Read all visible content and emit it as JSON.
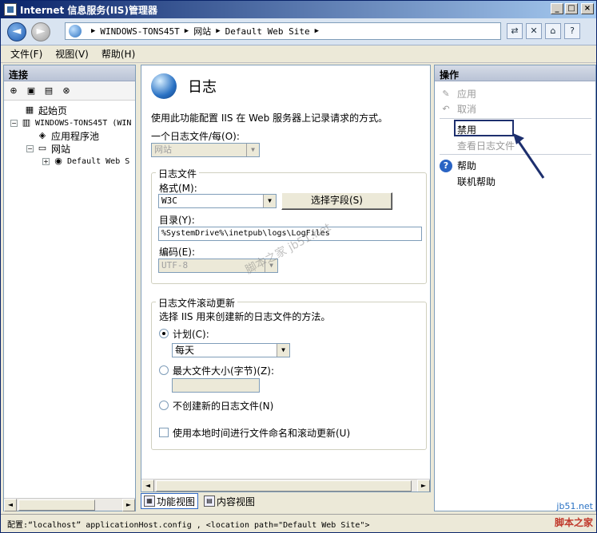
{
  "window": {
    "title": "Internet 信息服务(IIS)管理器",
    "min": "_",
    "max": "□",
    "close": "×"
  },
  "address": {
    "nav_back": "◄",
    "nav_forward": "►",
    "sep": "▶",
    "segments": [
      "WINDOWS-TONS45T",
      "网站",
      "Default Web Site"
    ],
    "tb_icons": [
      "⇄",
      "✕",
      "⌂",
      "?"
    ]
  },
  "menu": {
    "file": "文件(F)",
    "view": "视图(V)",
    "help": "帮助(H)"
  },
  "left": {
    "header": "连接",
    "tree": {
      "start_page": "起始页",
      "server": "WINDOWS-TONS45T (WIN",
      "app_pools": "应用程序池",
      "sites": "网站",
      "default_site": "Default Web S"
    },
    "expand_minus": "−",
    "expand_plus": "+"
  },
  "center": {
    "title": "日志",
    "description": "使用此功能配置 IIS 在 Web 服务器上记录请求的方式。",
    "one_log_per_label": "一个日志文件/每(O):",
    "one_log_per_value": "网站",
    "log_file_group": "日志文件",
    "format_label": "格式(M):",
    "format_value": "W3C",
    "select_fields_button": "选择字段(S)",
    "directory_label": "目录(Y):",
    "directory_value": "%SystemDrive%\\inetpub\\logs\\LogFiles",
    "encoding_label": "编码(E):",
    "encoding_value": "UTF-8",
    "rollover_group": "日志文件滚动更新",
    "rollover_desc": "选择 IIS 用来创建新的日志文件的方法。",
    "schedule_label": "计划(C):",
    "schedule_value": "每天",
    "max_size_label": "最大文件大小(字节)(Z):",
    "max_size_value": "",
    "no_new_log_label": "不创建新的日志文件(N)",
    "use_local_time_label": "使用本地时间进行文件命名和滚动更新(U)",
    "dropdown_arrow": "▼",
    "scroll_left": "◄",
    "scroll_right": "►"
  },
  "view_tabs": {
    "features": "功能视图",
    "content": "内容视图"
  },
  "right": {
    "header": "操作",
    "apply": "应用",
    "cancel": "取消",
    "disable": "禁用",
    "view_log_files": "查看日志文件",
    "help": "帮助",
    "online_help": "联机帮助"
  },
  "status": {
    "text": "配置:“localhost” applicationHost.config , <location path=\"Default Web Site\">"
  },
  "watermarks": {
    "center": "脚本之家 jb51.net",
    "corner1": "jb51.net",
    "corner2": "脚本之家"
  },
  "colors": {
    "titlebar_start": "#0a246a",
    "accent": "#2a64c4",
    "highlight_box": "#1d2f6e"
  }
}
